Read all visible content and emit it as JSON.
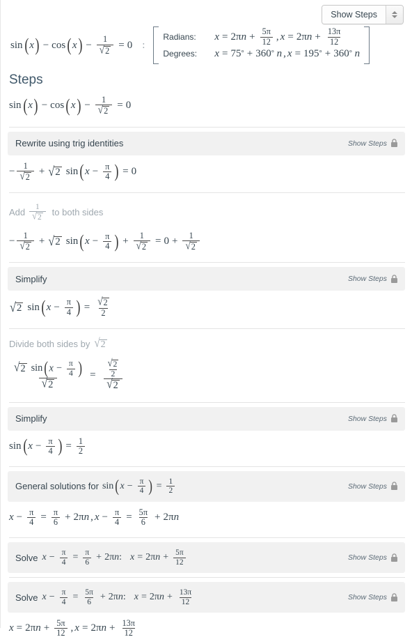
{
  "header": {
    "dropdown": {
      "label": "Show Steps",
      "icon": "updown-spinner-icon"
    }
  },
  "problem": {
    "equation_text": "sin(x) - cos(x) - 1/sqrt(2) = 0",
    "separator": ":",
    "solutions": {
      "radians": {
        "label": "Radians:",
        "value_text": "x = 2πn + 5π/12 , x = 2πn + 13π/12",
        "n_symbol": "n",
        "first": {
          "coeff": "2",
          "pi": "π",
          "var": "n",
          "num": "5π",
          "den": "12"
        },
        "second": {
          "coeff": "2",
          "pi": "π",
          "var": "n",
          "num": "13π",
          "den": "12"
        }
      },
      "degrees": {
        "label": "Degrees:",
        "value_text": "x = 75° + 360°n , x = 195° + 360°n",
        "first_angle": "75",
        "first_period": "360",
        "second_angle": "195",
        "second_period": "360",
        "degree_symbol": "°",
        "n_symbol": "n"
      }
    }
  },
  "steps": {
    "title": "Steps",
    "initial_equation_text": "sin(x) - cos(x) - 1/sqrt(2) = 0",
    "show_steps_label": "Show Steps",
    "lock_icon": "lock-icon",
    "items": [
      {
        "kind": "bar",
        "title": "Rewrite using trig identities",
        "result_text": "-1/sqrt(2) + sqrt(2) sin(x - π/4) = 0"
      },
      {
        "kind": "plain",
        "title_prefix": "Add",
        "title_suffix": "to both sides",
        "fraction": {
          "num": "1",
          "den": "sqrt(2)"
        },
        "result_text": "-1/sqrt(2) + sqrt(2) sin(x - π/4) + 1/sqrt(2) = 0 + 1/sqrt(2)"
      },
      {
        "kind": "bar",
        "title": "Simplify",
        "result_text": "sqrt(2) sin(x - π/4) = sqrt(2)/2"
      },
      {
        "kind": "plain",
        "title_prefix": "Divide both sides by",
        "title_suffix": "",
        "radicand": "2",
        "result_text": "( sqrt(2) sin(x - π/4) ) / sqrt(2) = ( sqrt(2)/2 ) / sqrt(2)"
      },
      {
        "kind": "bar",
        "title": "Simplify",
        "result_text": "sin(x - π/4) = 1/2"
      },
      {
        "kind": "bar",
        "title_prefix": "General solutions for",
        "title_equation": "sin(x - π/4) = 1/2",
        "result_text": "x - π/4 = π/6 + 2πn , x - π/4 = 5π/6 + 2πn"
      },
      {
        "kind": "bar",
        "title_prefix": "Solve",
        "title_equation": "x - π/4 = π/6 + 2πn:",
        "title_result": "x = 2πn + 5π/12"
      },
      {
        "kind": "bar",
        "title_prefix": "Solve",
        "title_equation": "x - π/4 = 5π/6 + 2πn:",
        "title_result": "x = 2πn + 13π/12"
      }
    ],
    "final_answer_text": "x = 2πn + 5π/12 , x = 2πn + 13π/12"
  },
  "labels": {
    "solve_word": "Solve",
    "general_solutions_word": "General solutions for",
    "add_word": "Add",
    "to_both_sides": "to both sides",
    "divide_both_sides_by": "Divide both sides by",
    "simplify": "Simplify",
    "rewrite_trig": "Rewrite using trig identities"
  },
  "colors": {
    "bar_background": "#f1f1f1",
    "text": "#36454f",
    "muted_text": "#9fa8af",
    "divider": "#e4e4e4",
    "heading": "#41596b"
  }
}
